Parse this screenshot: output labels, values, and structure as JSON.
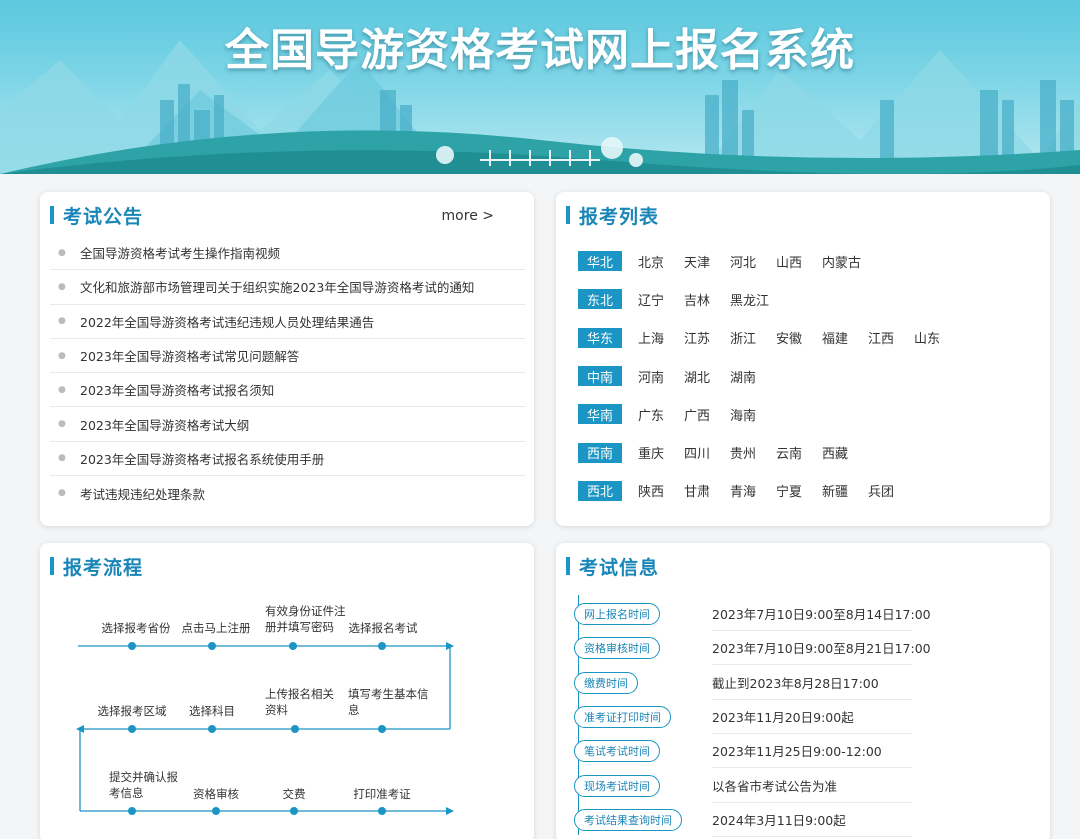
{
  "banner": {
    "title": "全国导游资格考试网上报名系统"
  },
  "notice": {
    "title": "考试公告",
    "more": "more >",
    "items": [
      "全国导游资格考试考生操作指南视频",
      "文化和旅游部市场管理司关于组织实施2023年全国导游资格考试的通知",
      "2022年全国导游资格考试违纪违规人员处理结果通告",
      "2023年全国导游资格考试常见问题解答",
      "2023年全国导游资格考试报名须知",
      "2023年全国导游资格考试大纲",
      "2023年全国导游资格考试报名系统使用手册",
      "考试违规违纪处理条款"
    ]
  },
  "regions": {
    "title": "报考列表",
    "rows": [
      {
        "name": "华北",
        "provinces": [
          "北京",
          "天津",
          "河北",
          "山西",
          "内蒙古"
        ]
      },
      {
        "name": "东北",
        "provinces": [
          "辽宁",
          "吉林",
          "黑龙江"
        ]
      },
      {
        "name": "华东",
        "provinces": [
          "上海",
          "江苏",
          "浙江",
          "安徽",
          "福建",
          "江西",
          "山东"
        ]
      },
      {
        "name": "中南",
        "provinces": [
          "河南",
          "湖北",
          "湖南"
        ]
      },
      {
        "name": "华南",
        "provinces": [
          "广东",
          "广西",
          "海南"
        ]
      },
      {
        "name": "西南",
        "provinces": [
          "重庆",
          "四川",
          "贵州",
          "云南",
          "西藏"
        ]
      },
      {
        "name": "西北",
        "provinces": [
          "陕西",
          "甘肃",
          "青海",
          "宁夏",
          "新疆",
          "兵团"
        ]
      }
    ]
  },
  "flow": {
    "title": "报考流程",
    "steps": [
      "选择报考省份",
      "点击马上注册",
      "有效身份证件注册并填写密码",
      "选择报名考试",
      "填写考生基本信息",
      "上传报名相关资料",
      "选择科目",
      "选择报考区域",
      "提交并确认报考信息",
      "资格审核",
      "交费",
      "打印准考证"
    ]
  },
  "info": {
    "title": "考试信息",
    "rows": [
      {
        "label": "网上报名时间",
        "value": "2023年7月10日9:00至8月14日17:00"
      },
      {
        "label": "资格审核时间",
        "value": "2023年7月10日9:00至8月21日17:00"
      },
      {
        "label": "缴费时间",
        "value": "截止到2023年8月28日17:00"
      },
      {
        "label": "准考证打印时间",
        "value": "2023年11月20日9:00起"
      },
      {
        "label": "笔试考试时间",
        "value": "2023年11月25日9:00-12:00"
      },
      {
        "label": "现场考试时间",
        "value": "以各省市考试公告为准"
      },
      {
        "label": "考试结果查询时间",
        "value": "2024年3月11日9:00起"
      }
    ]
  },
  "colors": {
    "accent": "#1a95c4",
    "title": "#1a86b8"
  }
}
